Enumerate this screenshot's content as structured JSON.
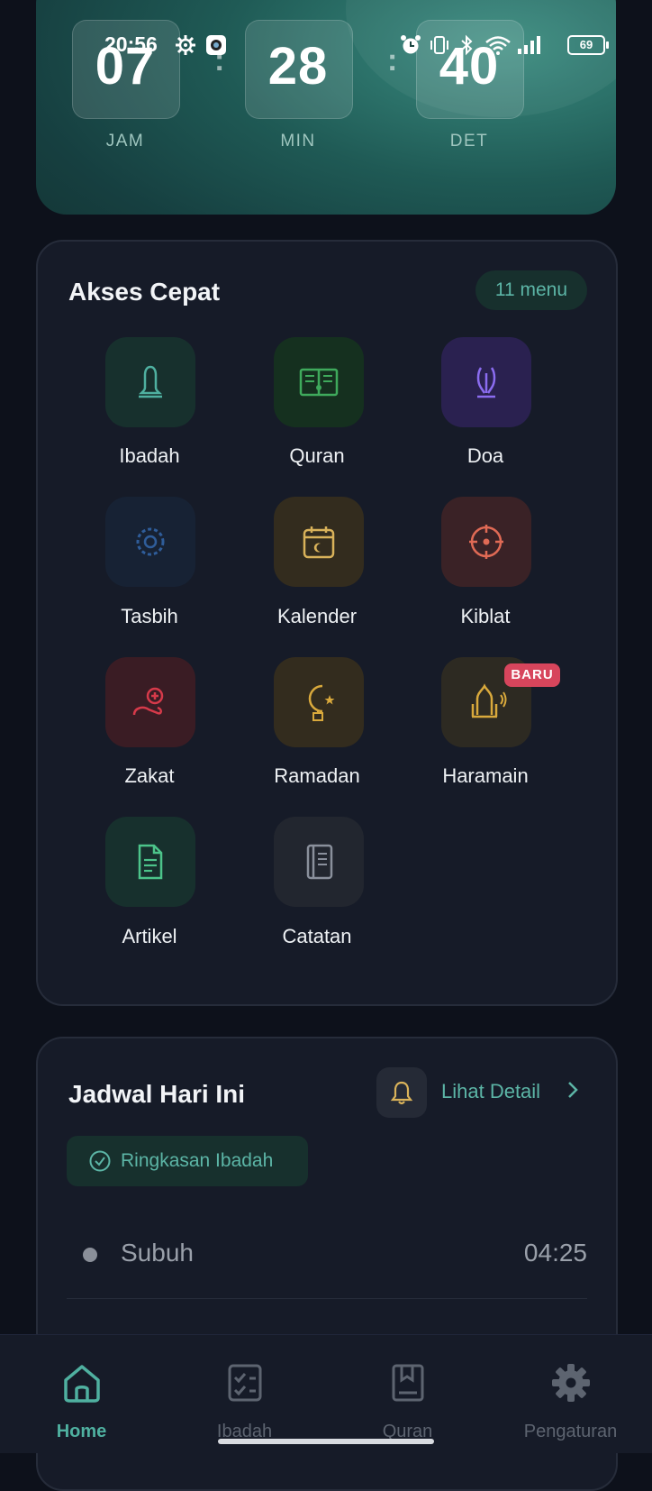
{
  "status_bar": {
    "time": "20:56",
    "battery": "69"
  },
  "countdown": {
    "hours": "07",
    "minutes": "28",
    "seconds": "40",
    "hours_label": "JAM",
    "minutes_label": "MIN",
    "seconds_label": "DET",
    "separator": ":"
  },
  "quick_access": {
    "title": "Akses Cepat",
    "count_label": "11 menu",
    "items": [
      {
        "label": "Ibadah",
        "icon": "bell-icon",
        "color": "#4fb0a0"
      },
      {
        "label": "Quran",
        "icon": "open-book-icon",
        "color": "#3faa5c"
      },
      {
        "label": "Doa",
        "icon": "praying-hands-icon",
        "color": "#8b6cf0"
      },
      {
        "label": "Tasbih",
        "icon": "prayer-beads-icon",
        "color": "#2f5d9a"
      },
      {
        "label": "Kalender",
        "icon": "calendar-moon-icon",
        "color": "#d9b25a"
      },
      {
        "label": "Kiblat",
        "icon": "compass-icon",
        "color": "#e06a55"
      },
      {
        "label": "Zakat",
        "icon": "coin-hand-icon",
        "color": "#d63a4a"
      },
      {
        "label": "Ramadan",
        "icon": "crescent-star-icon",
        "color": "#d9a93c"
      },
      {
        "label": "Haramain",
        "icon": "mosque-broadcast-icon",
        "color": "#d9a93c"
      },
      {
        "label": "Artikel",
        "icon": "document-icon",
        "color": "#4cc48a"
      },
      {
        "label": "Catatan",
        "icon": "notebook-icon",
        "color": "#8a909c"
      }
    ],
    "new_badge": "BARU"
  },
  "schedule": {
    "title": "Jadwal Hari Ini",
    "detail_label": "Lihat Detail",
    "summary_label": "Ringkasan Ibadah",
    "prayers": [
      {
        "name": "Subuh",
        "time": "04:25"
      }
    ]
  },
  "nav": {
    "items": [
      {
        "label": "Home",
        "icon": "home-icon",
        "active": true
      },
      {
        "label": "Ibadah",
        "icon": "checklist-icon",
        "active": false
      },
      {
        "label": "Quran",
        "icon": "book-icon",
        "active": false
      },
      {
        "label": "Pengaturan",
        "icon": "gear-icon",
        "active": false
      }
    ]
  }
}
